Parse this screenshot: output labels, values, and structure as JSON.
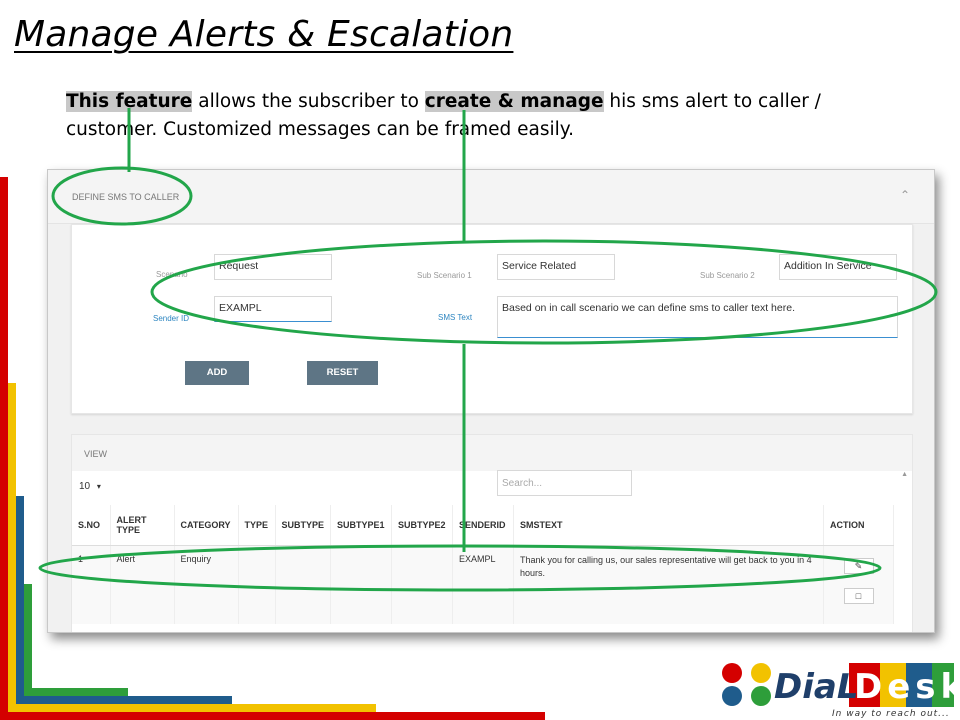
{
  "slide": {
    "title": "Manage Alerts & Escalation",
    "desc": {
      "hl1": "This feature",
      "t1": " allows the subscriber to ",
      "hl2": "create & manage",
      "t2": " his sms alert to caller / customer.  Customized messages can be framed easily."
    }
  },
  "panel": {
    "title": "DEFINE SMS TO CALLER",
    "collapse_icon": "chevron-up-icon",
    "form": {
      "scenario_label": "Scenario",
      "scenario_value": "Request",
      "sub_scenario1_label": "Sub Scenario 1",
      "sub_scenario1_value": "Service Related",
      "sub_scenario2_label": "Sub Scenario 2",
      "sub_scenario2_value": "Addition In Service",
      "sender_id_label": "Sender ID",
      "sender_id_value": "EXAMPL",
      "sms_text_label": "SMS Text",
      "sms_text_value": "Based on in call scenario we can define sms to caller text here.",
      "add_label": "ADD",
      "reset_label": "RESET"
    }
  },
  "view": {
    "title": "VIEW",
    "page_length": "10",
    "page_length_caret": "▾",
    "search_placeholder": "Search...",
    "columns": [
      "S.NO",
      "ALERT TYPE",
      "CATEGORY",
      "TYPE",
      "SUBTYPE",
      "SUBTYPE1",
      "SUBTYPE2",
      "SENDERID",
      "SMSTEXT",
      "ACTION"
    ],
    "rows": [
      {
        "sno": "1",
        "alert_type": "Alert",
        "category": "Enquiry",
        "type": "",
        "subtype": "",
        "subtype1": "",
        "subtype2": "",
        "senderid": "EXAMPL",
        "smstext": "Thank you for calling us, our sales representative will get back to you in 4 hours.",
        "edit_icon": "edit-icon",
        "delete_icon": "trash-icon"
      }
    ]
  },
  "brand": {
    "name_part1": "DiaL",
    "name_part2": "Desk",
    "tagline": "In way to reach out...",
    "colors": {
      "red": "#d40000",
      "yellow": "#f2c200",
      "blue": "#1f5c8c",
      "green": "#2e9e3a",
      "annotation": "#22a64a"
    }
  }
}
